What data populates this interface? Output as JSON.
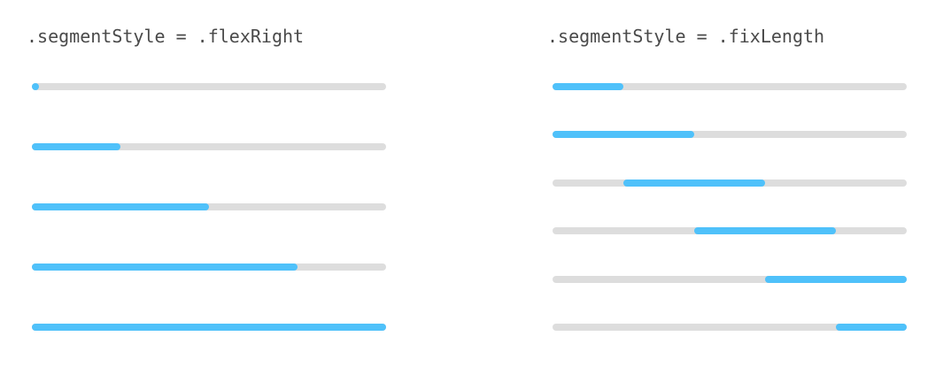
{
  "panels": [
    {
      "title": ".segmentStyle = .flexRight",
      "style": "flexRight",
      "bars": [
        {
          "progress": 0.0
        },
        {
          "progress": 0.25
        },
        {
          "progress": 0.5
        },
        {
          "progress": 0.75
        },
        {
          "progress": 1.0
        }
      ]
    },
    {
      "title": ".segmentStyle = .fixLength",
      "style": "fixLength",
      "segment_fraction": 0.4,
      "bars": [
        {
          "progress": 0.0
        },
        {
          "progress": 0.2
        },
        {
          "progress": 0.4
        },
        {
          "progress": 0.6
        },
        {
          "progress": 0.8
        },
        {
          "progress": 1.0
        }
      ]
    }
  ],
  "colors": {
    "track": "#dddddd",
    "segment": "#4fc1fa",
    "text": "#4a4a4a",
    "background": "#ffffff"
  }
}
